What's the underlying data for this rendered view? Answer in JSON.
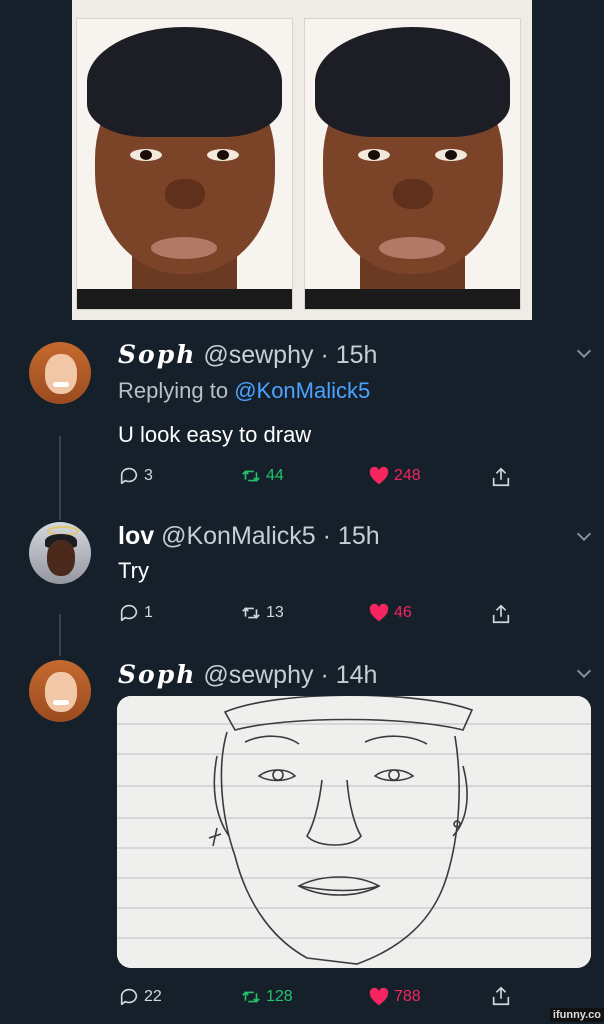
{
  "tweets": [
    {
      "name": "Soph",
      "handle": "@sewphy",
      "sep": "·",
      "time": "15h",
      "replying_prefix": "Replying to ",
      "replying_handle": "@KonMalick5",
      "text": "U look easy to draw",
      "replies": "3",
      "retweets": "44",
      "likes": "248"
    },
    {
      "name": "lov",
      "handle": "@KonMalick5",
      "sep": "·",
      "time": "15h",
      "text": "Try",
      "replies": "1",
      "retweets": "13",
      "likes": "46"
    },
    {
      "name": "Soph",
      "handle": "@sewphy",
      "sep": "·",
      "time": "14h",
      "replies": "22",
      "retweets": "128",
      "likes": "788"
    }
  ],
  "colors": {
    "background": "#15202b",
    "mention": "#4ca2ff",
    "retweet": "#25c26c",
    "like": "#f4255f"
  },
  "icons": [
    "reply-icon",
    "retweet-icon",
    "like-icon",
    "share-icon",
    "chevron-down-icon"
  ],
  "watermark": "ifunny.co"
}
